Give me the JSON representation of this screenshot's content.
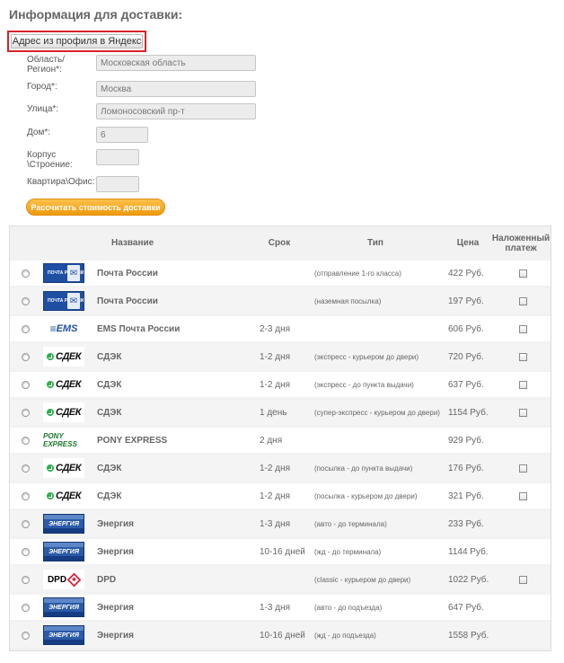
{
  "page_title": "Информация для доставки:",
  "yandex_button_label": "Адрес из профиля в Яндекс",
  "form": {
    "region_label": "Область/ Регион*:",
    "region_value": "Московская область",
    "city_label": "Город*:",
    "city_value": "Москва",
    "street_label": "Улица*:",
    "street_value": "Ломоносовский пр-т",
    "house_label": "Дом*:",
    "house_value": "6",
    "building_label": "Корпус \\Строение:",
    "building_value": "",
    "apartment_label": "Квартира\\Офис:",
    "apartment_value": ""
  },
  "calc_button_label": "Рассчитать стоимость доставки",
  "table": {
    "headers": {
      "name": "Название",
      "term": "Срок",
      "type": "Тип",
      "price": "Цена",
      "cod": "Наложенный платеж"
    },
    "rows": [
      {
        "logo": "pochta",
        "logo_text": "ПОЧТА РОССИИ",
        "name": "Почта России",
        "term": "",
        "type": "(отправление 1-го класса)",
        "price": "422 Руб.",
        "cod": true
      },
      {
        "logo": "pochta",
        "logo_text": "ПОЧТА РОССИИ",
        "name": "Почта России",
        "term": "",
        "type": "(наземная посылка)",
        "price": "197 Руб.",
        "cod": true
      },
      {
        "logo": "ems",
        "logo_text": "EMS",
        "name": "EMS Почта России",
        "term": "2-3 дня",
        "type": "",
        "price": "606 Руб.",
        "cod": true
      },
      {
        "logo": "cdek",
        "logo_text": "СДЕК",
        "name": "СДЭК",
        "term": "1-2 дня",
        "type": "(экспресс - курьером до двери)",
        "price": "720 Руб.",
        "cod": true
      },
      {
        "logo": "cdek",
        "logo_text": "СДЕК",
        "name": "СДЭК",
        "term": "1-2 дня",
        "type": "(экспресс - до пункта выдачи)",
        "price": "637 Руб.",
        "cod": true
      },
      {
        "logo": "cdek",
        "logo_text": "СДЕК",
        "name": "СДЭК",
        "term": "1 день",
        "type": "(супер-экспресс - курьером до двери)",
        "price": "1154 Руб.",
        "cod": true
      },
      {
        "logo": "pony",
        "logo_text": "PONY EXPRESS",
        "name": "PONY EXPRESS",
        "term": "2 дня",
        "type": "",
        "price": "929 Руб.",
        "cod": false
      },
      {
        "logo": "cdek",
        "logo_text": "СДЕК",
        "name": "СДЭК",
        "term": "1-2 дня",
        "type": "(посылка - до пункта выдачи)",
        "price": "176 Руб.",
        "cod": true
      },
      {
        "logo": "cdek",
        "logo_text": "СДЕК",
        "name": "СДЭК",
        "term": "1-2 дня",
        "type": "(посылка - курьером до двери)",
        "price": "321 Руб.",
        "cod": true
      },
      {
        "logo": "energia",
        "logo_text": "ЭНЕРГИЯ",
        "name": "Энергия",
        "term": "1-3 дня",
        "type": "(авто - до терминала)",
        "price": "233 Руб.",
        "cod": false
      },
      {
        "logo": "energia",
        "logo_text": "ЭНЕРГИЯ",
        "name": "Энергия",
        "term": "10-16 дней",
        "type": "(жд - до терминала)",
        "price": "1144 Руб.",
        "cod": false
      },
      {
        "logo": "dpd",
        "logo_text": "DPD",
        "name": "DPD",
        "term": "",
        "type": "(classic - курьером до двери)",
        "price": "1022 Руб.",
        "cod": true
      },
      {
        "logo": "energia",
        "logo_text": "ЭНЕРГИЯ",
        "name": "Энергия",
        "term": "1-3 дня",
        "type": "(авто - до подъезда)",
        "price": "647 Руб.",
        "cod": false
      },
      {
        "logo": "energia",
        "logo_text": "ЭНЕРГИЯ",
        "name": "Энергия",
        "term": "10-16 дней",
        "type": "(жд - до подъезда)",
        "price": "1558 Руб.",
        "cod": false
      }
    ]
  },
  "colors": {
    "accent_orange": "#f5a623",
    "highlight_red": "#d8232a",
    "pochta_blue": "#1f4fa3",
    "cdek_green": "#2eae4e",
    "pony_green": "#1a7a2a",
    "dpd_red": "#d61f32"
  }
}
